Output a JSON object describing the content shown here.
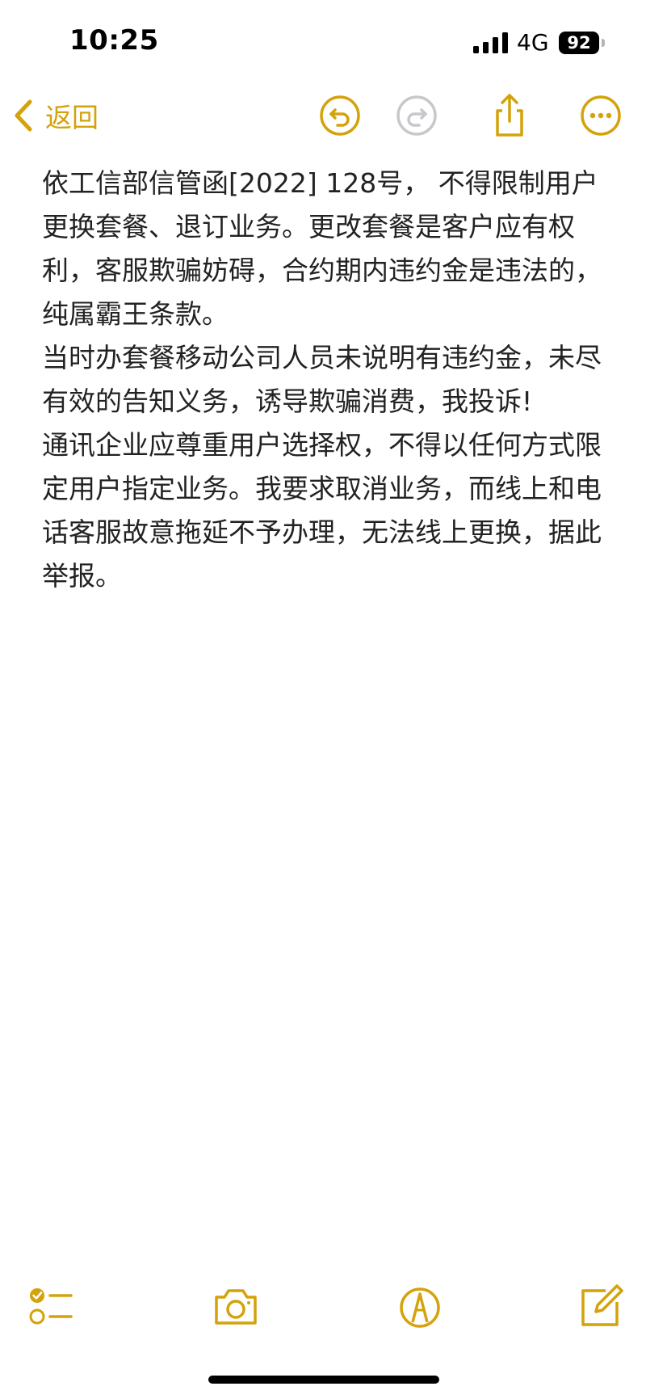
{
  "status_bar": {
    "time": "10:25",
    "network": "4G",
    "battery": "92"
  },
  "toolbar": {
    "back_label": "返回",
    "icons": [
      "chevron-left-icon",
      "undo-icon",
      "redo-icon",
      "share-icon",
      "more-icon"
    ]
  },
  "note": {
    "paragraphs": [
      "依工信部信管函[2022] 128号， 不得限制用户更换套餐、退订业务。更改套餐是客户应有权利，客服欺骗妨碍，合约期内违约金是违法的，纯属霸王条款。",
      "当时办套餐移动公司人员未说明有违约金，未尽有效的告知义务，诱导欺骗消费，我投诉!",
      "通讯企业应尊重用户选择权，不得以任何方式限定用户指定业务。我要求取消业务，而线上和电话客服故意拖延不予办理，无法线上更换，据此举报。"
    ]
  },
  "bottom_toolbar": {
    "icons": [
      "checklist-icon",
      "camera-icon",
      "markup-icon",
      "compose-icon"
    ]
  },
  "colors": {
    "accent": "#d4a20a",
    "text": "#222222",
    "disabled": "#c7c7cc",
    "background": "#ffffff"
  }
}
